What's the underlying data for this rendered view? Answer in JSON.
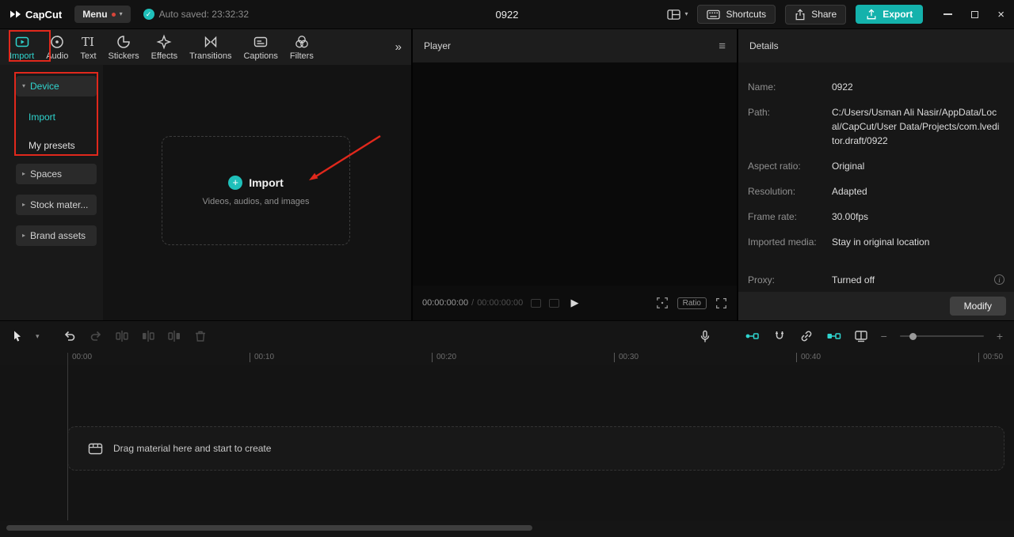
{
  "colors": {
    "accent": "#2fd4ce",
    "export_button": "#14b2ac",
    "annotation": "#e0281c"
  },
  "icons": {
    "caret_down": "▾",
    "caret_right": "▸",
    "chevron_double": "»",
    "hamburger": "≡",
    "check": "✓",
    "close": "×",
    "play": "▶",
    "minus": "−",
    "plus": "+",
    "plus_sign": "+",
    "info": "i"
  },
  "titlebar": {
    "app_name": "CapCut",
    "menu_label": "Menu",
    "autosave_text": "Auto saved: 23:32:32",
    "project_title": "0922",
    "shortcuts_label": "Shortcuts",
    "share_label": "Share",
    "export_label": "Export"
  },
  "media_tabs": [
    {
      "label": "Import"
    },
    {
      "label": "Audio"
    },
    {
      "label": "Text"
    },
    {
      "label": "Stickers"
    },
    {
      "label": "Effects"
    },
    {
      "label": "Transitions"
    },
    {
      "label": "Captions"
    },
    {
      "label": "Filters"
    }
  ],
  "sidebar": {
    "device": {
      "label": "Device"
    },
    "device_children": [
      {
        "label": "Import"
      },
      {
        "label": "My presets"
      }
    ],
    "groups": [
      {
        "label": "Spaces"
      },
      {
        "label": "Stock mater..."
      },
      {
        "label": "Brand assets"
      }
    ]
  },
  "import_area": {
    "button_label": "Import",
    "subtitle": "Videos, audios, and images"
  },
  "player": {
    "title": "Player",
    "current_time": "00:00:00:00",
    "separator": "/",
    "total_time": "00:00:00:00",
    "ratio_label": "Ratio"
  },
  "details": {
    "title": "Details",
    "rows": [
      {
        "label": "Name:",
        "value": "0922"
      },
      {
        "label": "Path:",
        "value": "C:/Users/Usman Ali Nasir/AppData/Local/CapCut/User Data/Projects/com.lveditor.draft/0922"
      },
      {
        "label": "Aspect ratio:",
        "value": "Original"
      },
      {
        "label": "Resolution:",
        "value": "Adapted"
      },
      {
        "label": "Frame rate:",
        "value": "30.00fps"
      },
      {
        "label": "Imported media:",
        "value": "Stay in original location"
      },
      {
        "label": "Proxy:",
        "value": "Turned off"
      }
    ],
    "modify_label": "Modify"
  },
  "timeline": {
    "ruler": [
      "00:00",
      "00:10",
      "00:20",
      "00:30",
      "00:40",
      "00:50"
    ],
    "empty_text": "Drag material here and start to create"
  }
}
